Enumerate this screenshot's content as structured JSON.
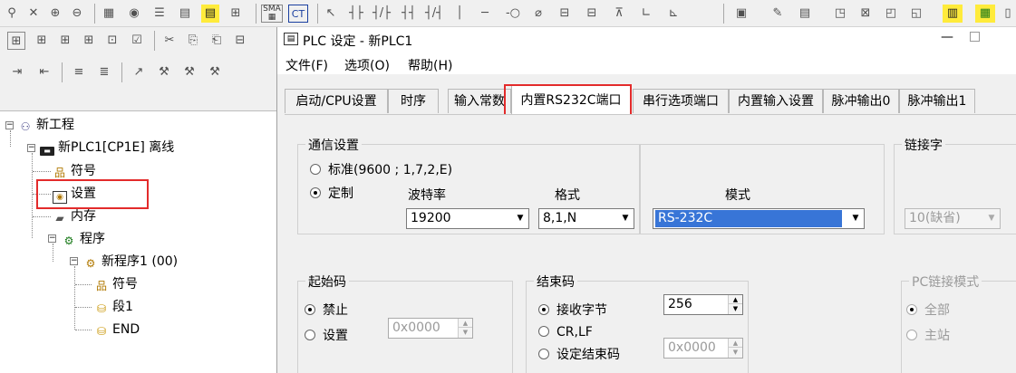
{
  "plc_window": {
    "title": "PLC 设定 - 新PLC1",
    "menu": [
      "文件(F)",
      "选项(O)",
      "帮助(H)"
    ],
    "tabs": [
      "启动/CPU设置",
      "时序",
      "输入常数",
      "内置RS232C端口",
      "串行选项端口",
      "内置输入设置",
      "脉冲输出0",
      "脉冲输出1"
    ],
    "active_tab": "内置RS232C端口"
  },
  "comm": {
    "legend": "通信设置",
    "standard_label": "标准(9600 ; 1,7,2,E)",
    "custom_label": "定制",
    "baud_label": "波特率",
    "baud_value": "19200",
    "format_label": "格式",
    "format_value": "8,1,N",
    "mode_label": "模式",
    "mode_value": "RS-232C",
    "selected": "custom"
  },
  "link": {
    "legend": "链接字",
    "value": "10(缺省)"
  },
  "start_code": {
    "legend": "起始码",
    "disable_label": "禁止",
    "set_label": "设置",
    "value": "0x0000",
    "selected": "disable"
  },
  "end_code": {
    "legend": "结束码",
    "recv_bytes_label": "接收字节",
    "recv_bytes_value": "256",
    "crlf_label": "CR,LF",
    "set_end_label": "设定结束码",
    "end_value": "0x0000",
    "selected": "recv_bytes"
  },
  "pc_link": {
    "legend": "PC链接模式",
    "all_label": "全部",
    "master_label": "主站"
  },
  "tree": {
    "project": "新工程",
    "plc": "新PLC1[CP1E] 离线",
    "symbols": "符号",
    "settings": "设置",
    "memory": "内存",
    "programs": "程序",
    "new_program": "新程序1 (00)",
    "prog_symbols": "符号",
    "section": "段1",
    "end": "END"
  },
  "colors": {
    "highlight": "#e32b2b",
    "selection": "#3875d7"
  }
}
